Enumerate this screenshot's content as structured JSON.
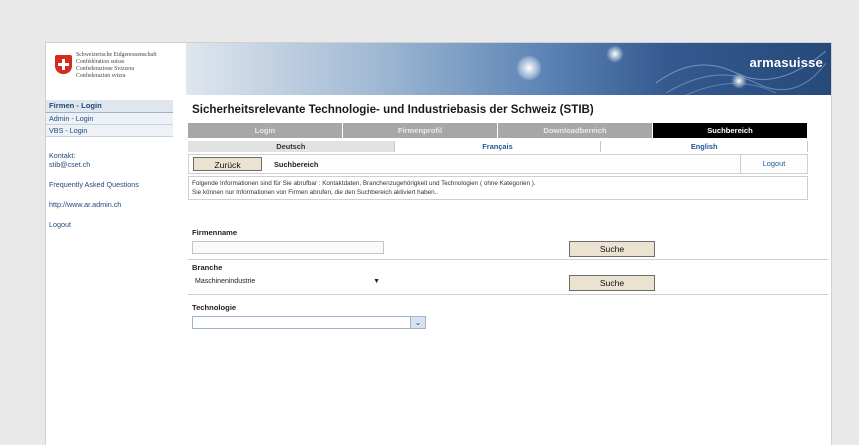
{
  "header": {
    "confederation_lines": [
      "Schweizerische Eidgenossenschaft",
      "Confédération suisse",
      "Confederazione Svizzera",
      "Confederaziun svizra"
    ],
    "brand": "armasuisse"
  },
  "sidebar": {
    "items": [
      {
        "label": "Firmen - Login"
      },
      {
        "label": "Admin - Login"
      },
      {
        "label": "VBS - Login"
      }
    ],
    "contact_label": "Kontakt:",
    "contact_email": "stib@cset.ch",
    "faq": "Frequently Asked Questions",
    "website": "http://www.ar.admin.ch",
    "logout": "Logout"
  },
  "main": {
    "title": "Sicherheitsrelevante Technologie- und Industriebasis der Schweiz (STIB)",
    "tabs": [
      {
        "label": "Login"
      },
      {
        "label": "Firmenprofil"
      },
      {
        "label": "Downloadbereich"
      },
      {
        "label": "Suchbereich"
      }
    ],
    "languages": [
      {
        "label": "Deutsch"
      },
      {
        "label": "Français"
      },
      {
        "label": "English"
      }
    ],
    "back_button": "Zurück",
    "breadcrumb": "Suchbereich",
    "logout": "Logout",
    "info_lines": [
      "Folgende Informationen sind für Sie abrufbar : Kontaktdaten, Branchenzugehörigkeit und Technologien ( ohne Kategorien ).",
      "Sie können nur Informationen von Firmen abrufen, die den Suchbereich aktiviert haben.."
    ],
    "firmenname_label": "Firmenname",
    "firmenname_value": "",
    "search_button_1": "Suche",
    "branche_label": "Branche",
    "branche_selected": "Maschinenindustrie",
    "search_button_2": "Suche",
    "technologie_label": "Technologie",
    "technologie_selected": ""
  },
  "colors": {
    "active_tab": "#000000",
    "inactive_tab": "#a7a7a7",
    "link": "#1e5a96",
    "flag_red": "#d52b1e",
    "button_bg": "#ece2d2"
  }
}
